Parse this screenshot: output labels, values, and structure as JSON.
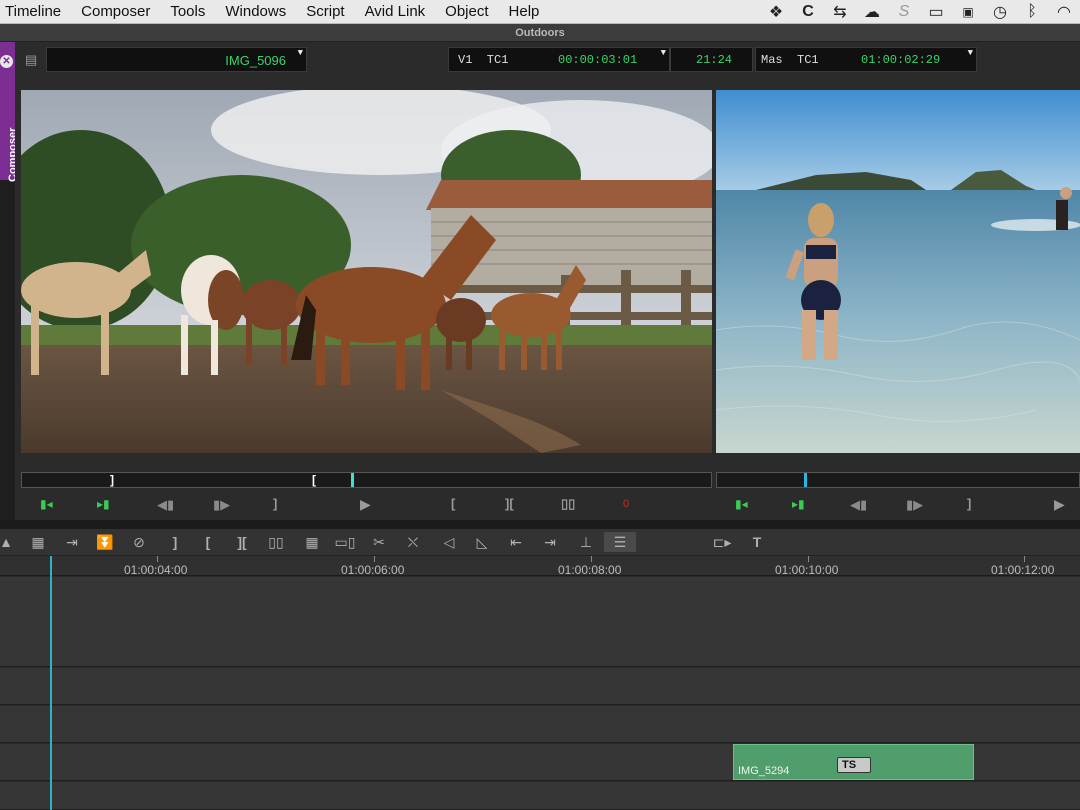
{
  "menubar": {
    "items": [
      "Timeline",
      "Composer",
      "Tools",
      "Windows",
      "Script",
      "Avid Link",
      "Object",
      "Help"
    ],
    "tray_icons": [
      "dropbox-icon",
      "c-icon",
      "control-icon",
      "creative-cloud-icon",
      "s-icon",
      "facetime-icon",
      "calendar-icon",
      "time-machine-icon",
      "bluetooth-icon",
      "wifi-icon"
    ]
  },
  "window": {
    "title": "Outdoors"
  },
  "composer_tab": {
    "label": "Composer",
    "close": "✕"
  },
  "source": {
    "clip_name": "IMG_5096"
  },
  "timecode": {
    "v1_label": "V1  TC1",
    "v1_value": "00:00:03:01",
    "duration": "21:24",
    "mas_label": "Mas  TC1",
    "mas_value": "01:00:02:29"
  },
  "toolbar": {
    "icons": [
      "arrow-up-icon",
      "segment-mode-icon",
      "splice-icon",
      "overwrite-icon",
      "clear-icon",
      "mark-out-icon",
      "mark-in-icon",
      "mark-clip-icon",
      "clear-marks-icon",
      "grid-icon",
      "match-frame-icon",
      "cut-icon",
      "lift-icon",
      "add-edit-icon",
      "trim-icon",
      "extract-icon",
      "lift-up-icon",
      "overwrite-down-icon",
      "collapse-icon",
      "source-record-icon",
      "title-icon"
    ]
  },
  "ruler": {
    "marks": [
      "01:00:04:00",
      "01:00:06:00",
      "01:00:08:00",
      "01:00:10:00",
      "01:00:12:00"
    ]
  },
  "timeline": {
    "clip_name": "IMG_5294",
    "clip_badge": "TS"
  },
  "colors": {
    "accent_green": "#38d56b",
    "composer_tab": "#7c2e93",
    "clip_green": "#4f9e6c",
    "playhead": "#2bb5c4"
  }
}
